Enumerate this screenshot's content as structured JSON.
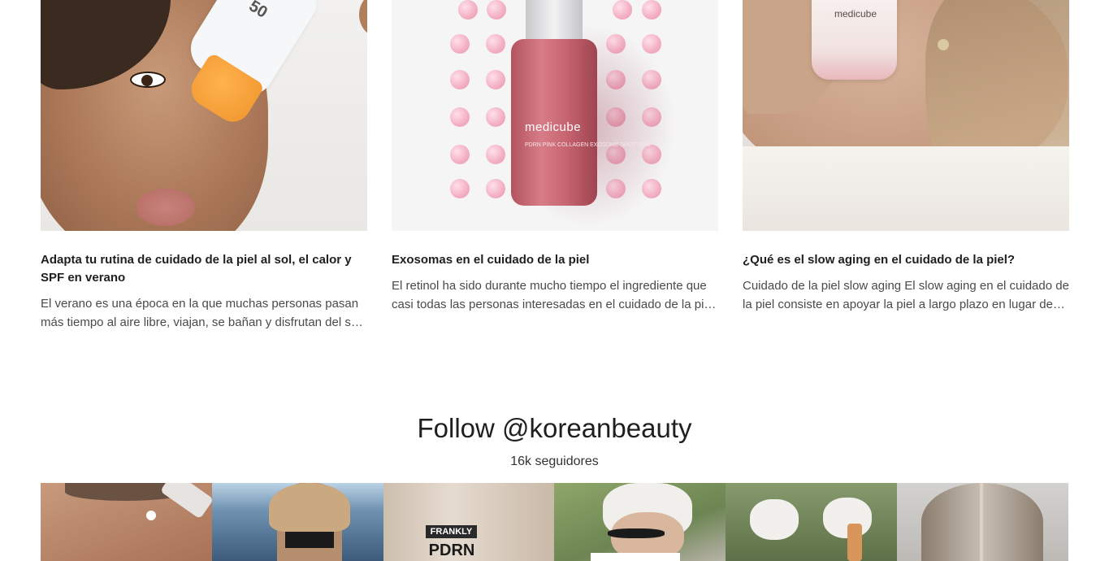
{
  "blog": {
    "articles": [
      {
        "title": "Adapta tu rutina de cuidado de la piel al sol, el calor y SPF en verano",
        "excerpt": "El verano es una época en la que muchas personas pasan más tiempo al aire libre, viajan, se bañan y disfrutan del sol y del calor.",
        "image_text": "50"
      },
      {
        "title": "Exosomas en el cuidado de la piel",
        "excerpt": "El retinol ha sido durante mucho tiempo el ingrediente que casi todas las personas interesadas en el cuidado de la piel conocen.",
        "image_text": "medicube",
        "image_subtext": "PDRN PINK COLLAGEN EXOSOME SHOT 2000"
      },
      {
        "title": "¿Qué es el slow aging en el cuidado de la piel?",
        "excerpt": "Cuidado de la piel slow aging El slow aging en el cuidado de la piel consiste en apoyar la piel a largo plazo en lugar de buscar resultados rápidos.",
        "image_text": "medicube"
      }
    ]
  },
  "follow": {
    "title": "Follow @koreanbeauty",
    "count": "16k seguidores",
    "tiles": [
      {
        "label": ""
      },
      {
        "label": ""
      },
      {
        "label": "FRANKLY",
        "sublabel": "PDRN"
      },
      {
        "label": ""
      },
      {
        "label": ""
      },
      {
        "label": ""
      }
    ]
  }
}
